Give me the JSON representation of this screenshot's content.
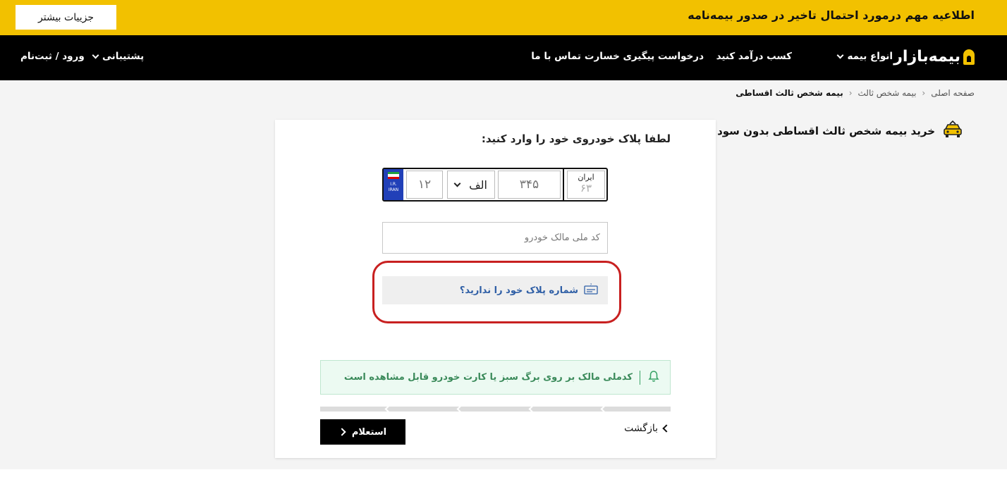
{
  "announcement": {
    "text": "اطلاعیه مهم درمورد احتمال تاخیر در صدور بیمه‌نامه",
    "button_label": "جزییات بیشتر"
  },
  "nav": {
    "logo_text": "بیمه‌بازار",
    "items": [
      {
        "label": "انواع بیمه",
        "dropdown": true
      },
      {
        "label": "کسب درآمد کنید",
        "dropdown": false
      },
      {
        "label": "درخواست پیگیری خسارت",
        "dropdown": false
      },
      {
        "label": "تماس با ما",
        "dropdown": false
      }
    ],
    "support_label": "پشتیبانی",
    "login_label": "ورود / ثبت‌نام"
  },
  "breadcrumb": [
    "صفحه اصلی",
    "بیمه شخص ثالث",
    "بیمه شخص ثالث اقساطی"
  ],
  "page_title": "خرید بیمه شخص ثالث اقساطی بدون سود",
  "form": {
    "title": "لطفا پلاک خودروی خود را وارد کنید:",
    "plate": {
      "country_code": "I.R.",
      "country_name": "IRAN",
      "part1_placeholder": "۱۲",
      "letter_value": "الف",
      "part2_placeholder": "۳۴۵",
      "iran_label": "ایران",
      "iran_code_placeholder": "۶۳"
    },
    "national_id_placeholder": "کد ملی مالک خودرو",
    "no_plate_label": "شماره پلاک خود را ندارید؟",
    "notice_text": "کدملی مالک بر روی برگ سبز یا کارت خودرو قابل مشاهده است",
    "back_label": "بازگشت",
    "inquiry_label": "استعلام"
  },
  "colors": {
    "brand_yellow": "#f2c100",
    "nav_bg": "#000000",
    "link_blue": "#2f5fa6",
    "notice_green": "#3a8a5a",
    "annotation_red": "#c82020"
  }
}
